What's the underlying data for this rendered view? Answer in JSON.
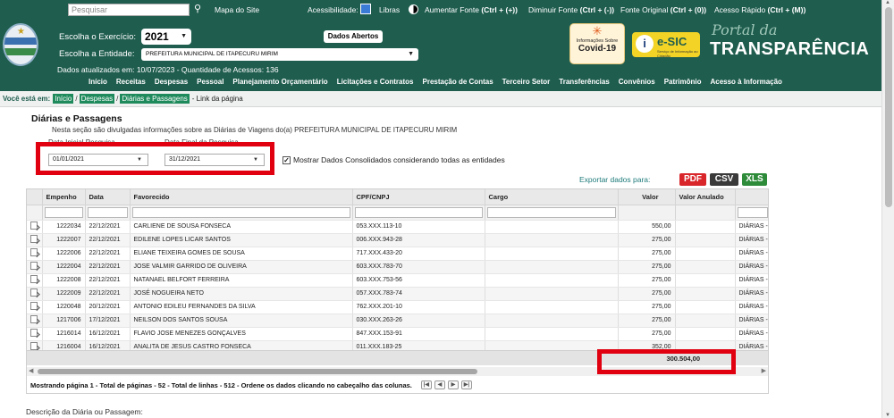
{
  "topbar": {
    "search_placeholder": "Pesquisar",
    "site_map": "Mapa do Site",
    "accessibility": "Acessibilidade:",
    "libras": "Libras",
    "increase_font": "Aumentar Fonte",
    "increase_font_keys": "(Ctrl + (+))",
    "decrease_font": "Diminuir Fonte",
    "decrease_font_keys": "(Ctrl + (-))",
    "original_font": "Fonte Original",
    "original_font_keys": "(Ctrl + (0))",
    "quick_access": "Acesso Rápido",
    "quick_access_keys": "(Ctrl + (M))"
  },
  "header": {
    "year_label": "Escolha o Exercício:",
    "year_value": "2021",
    "entity_label": "Escolha a Entidade:",
    "entity_value": "PREFEITURA MUNICIPAL DE ITAPECURU MIRIM",
    "updated_text": "Dados atualizados em: 10/07/2023 - Quantidade de Acessos: 136",
    "open_data": "Dados Abertos",
    "covid_small": "Informações Sobre",
    "covid_big": "Covid-19",
    "esic_title": "e-SIC",
    "esic_sub": "Serviço de Informação ao Cidadão",
    "portal_da": "Portal da",
    "portal_title": "TRANSPARÊNCIA"
  },
  "nav": [
    "Início",
    "Receitas",
    "Despesas",
    "Pessoal",
    "Planejamento Orçamentário",
    "Licitações e Contratos",
    "Prestação de Contas",
    "Terceiro Setor",
    "Transferências",
    "Convênios",
    "Patrimônio",
    "Acesso à Informação"
  ],
  "breadcrumb": {
    "lead": "Você está em:",
    "items": [
      "Início",
      "Despesas",
      "Diárias e Passagens"
    ],
    "current": "- Link da página"
  },
  "section": {
    "title": "Diárias e Passagens",
    "description": "Nesta seção são divulgadas informações sobre as Diárias de Viagens do(a) PREFEITURA MUNICIPAL DE ITAPECURU MIRIM",
    "start_label": "Data Inicial Pesquisa",
    "end_label": "Data Final da Pesquisa",
    "start_value": "01/01/2021",
    "end_value": "31/12/2021",
    "consolidated_label": "Mostrar Dados Consolidados considerando todas as entidades",
    "export_label": "Exportar dados para:",
    "export_pdf": "PDF",
    "export_csv": "CSV",
    "export_xls": "XLS",
    "description_footer": "Descrição da Diária ou Passagem:"
  },
  "colors": {
    "brand": "#1f5d4e",
    "highlight": "#e00010",
    "pdf": "#d9262b",
    "csv": "#3a3a3a",
    "xls": "#2e8b3a"
  },
  "table": {
    "columns": [
      "Empenho",
      "Data",
      "Favorecido",
      "CPF/CNPJ",
      "Cargo",
      "Valor",
      "Valor Anulado"
    ],
    "rows": [
      {
        "empenho": "1222034",
        "data": "22/12/2021",
        "favorecido": "CARLIENE DE SOUSA FONSECA",
        "cpf": "053.XXX.113-10",
        "cargo": "",
        "valor": "550,00",
        "anulado": "",
        "extra": "DIÁRIAS -"
      },
      {
        "empenho": "1222007",
        "data": "22/12/2021",
        "favorecido": "EDILENE LOPES LICAR SANTOS",
        "cpf": "006.XXX.943-28",
        "cargo": "",
        "valor": "275,00",
        "anulado": "",
        "extra": "DIÁRIAS -"
      },
      {
        "empenho": "1222006",
        "data": "22/12/2021",
        "favorecido": "ELIANE TEIXEIRA GOMES DE SOUSA",
        "cpf": "717.XXX.433-20",
        "cargo": "",
        "valor": "275,00",
        "anulado": "",
        "extra": "DIÁRIAS -"
      },
      {
        "empenho": "1222004",
        "data": "22/12/2021",
        "favorecido": "JOSE VALMIR GARRIDO DE OLIVEIRA",
        "cpf": "603.XXX.783-70",
        "cargo": "",
        "valor": "275,00",
        "anulado": "",
        "extra": "DIÁRIAS -"
      },
      {
        "empenho": "1222008",
        "data": "22/12/2021",
        "favorecido": "NATANAEL BELFORT FERREIRA",
        "cpf": "603.XXX.753-56",
        "cargo": "",
        "valor": "275,00",
        "anulado": "",
        "extra": "DIÁRIAS -"
      },
      {
        "empenho": "1222009",
        "data": "22/12/2021",
        "favorecido": "JOSÉ NOGUEIRA NETO",
        "cpf": "057.XXX.783-74",
        "cargo": "",
        "valor": "275,00",
        "anulado": "",
        "extra": "DIÁRIAS -"
      },
      {
        "empenho": "1220048",
        "data": "20/12/2021",
        "favorecido": "ANTONIO EDILEU FERNANDES DA SILVA",
        "cpf": "762.XXX.201-10",
        "cargo": "",
        "valor": "275,00",
        "anulado": "",
        "extra": "DIÁRIAS -"
      },
      {
        "empenho": "1217006",
        "data": "17/12/2021",
        "favorecido": "NEILSON DOS SANTOS SOUSA",
        "cpf": "030.XXX.263-26",
        "cargo": "",
        "valor": "275,00",
        "anulado": "",
        "extra": "DIÁRIAS -"
      },
      {
        "empenho": "1216014",
        "data": "16/12/2021",
        "favorecido": "FLAVIO JOSE MENEZES GONÇALVES",
        "cpf": "847.XXX.153-91",
        "cargo": "",
        "valor": "275,00",
        "anulado": "",
        "extra": "DIÁRIAS -"
      },
      {
        "empenho": "1216004",
        "data": "16/12/2021",
        "favorecido": "ANALITA DE JESUS CASTRO FONSECA",
        "cpf": "011.XXX.183-25",
        "cargo": "",
        "valor": "352,00",
        "anulado": "",
        "extra": "DIÁRIAS -"
      }
    ],
    "total": "300.504,00",
    "pager_text": "Mostrando página 1 - Total de páginas - 52 - Total de linhas - 512 - Ordene os dados clicando no cabeçalho das colunas."
  }
}
